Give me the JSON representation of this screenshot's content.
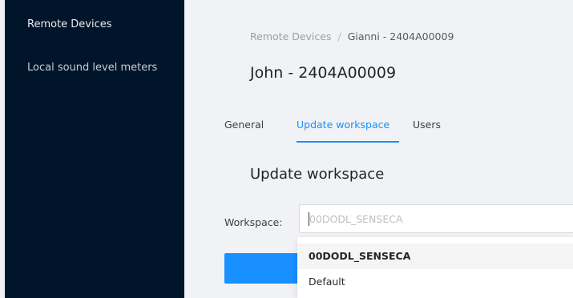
{
  "sidebar": {
    "items": [
      {
        "label": "Remote Devices"
      },
      {
        "label": "Local sound level meters"
      }
    ]
  },
  "breadcrumb": {
    "items": [
      "Remote Devices",
      "Gianni - 2404A00009"
    ],
    "separator": "/"
  },
  "page": {
    "title": "John - 2404A00009"
  },
  "tabs": [
    {
      "label": "General"
    },
    {
      "label": "Update workspace",
      "active": true
    },
    {
      "label": "Users"
    }
  ],
  "section": {
    "title": "Update workspace"
  },
  "form": {
    "workspace_label": "Workspace:",
    "workspace_placeholder": "00DODL_SENSECA"
  },
  "dropdown": {
    "options": [
      "00DODL_SENSECA",
      "Default"
    ],
    "selected": "00DODL_SENSECA"
  },
  "colors": {
    "sidebar_bg": "#001529",
    "accent": "#1890ff"
  }
}
